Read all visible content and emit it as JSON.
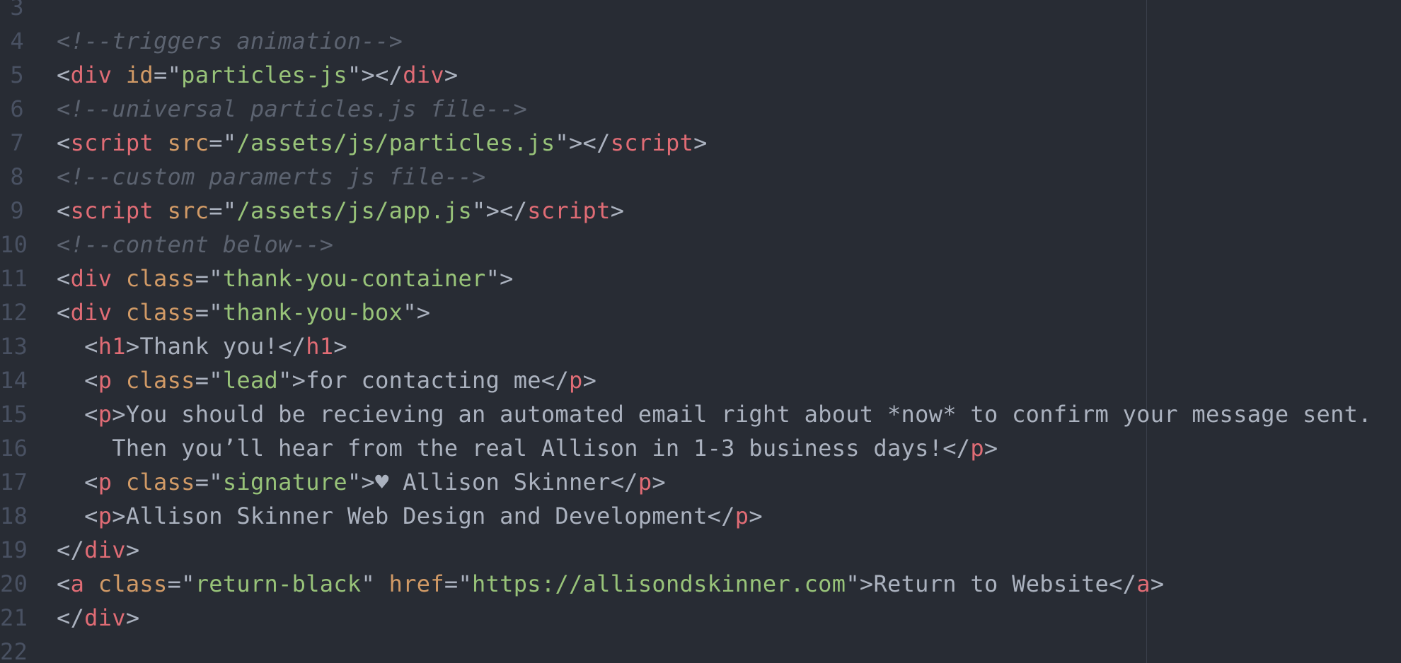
{
  "editor": {
    "colors": {
      "background": "#282c34",
      "tag": "#e06c75",
      "attribute": "#d19a66",
      "string": "#98c379",
      "comment": "#5c6370",
      "text": "#abb2bf",
      "gutter": "#495162"
    },
    "lines": [
      {
        "num": "3"
      },
      {
        "num": "4",
        "comment": "<!--triggers animation-->"
      },
      {
        "num": "5",
        "open": "<",
        "tag": "div",
        "attr": "id",
        "eq": "=\"",
        "val": "particles-js",
        "close": "\"></",
        "tag2": "div",
        "end": ">"
      },
      {
        "num": "6",
        "comment": "<!--universal particles.js file-->"
      },
      {
        "num": "7",
        "open": "<",
        "tag": "script",
        "attr": "src",
        "eq": "=\"",
        "val": "/assets/js/particles.js",
        "close": "\"></",
        "tag2": "script",
        "end": ">"
      },
      {
        "num": "8",
        "comment": "<!--custom paramerts js file-->"
      },
      {
        "num": "9",
        "open": "<",
        "tag": "script",
        "attr": "src",
        "eq": "=\"",
        "val": "/assets/js/app.js",
        "close": "\"></",
        "tag2": "script",
        "end": ">"
      },
      {
        "num": "10",
        "comment": "<!--content below-->"
      },
      {
        "num": "11",
        "open": "<",
        "tag": "div",
        "attr": "class",
        "eq": "=\"",
        "val": "thank-you-container",
        "end": "\">"
      },
      {
        "num": "12",
        "open": "<",
        "tag": "div",
        "attr": "class",
        "eq": "=\"",
        "val": "thank-you-box",
        "end": "\">"
      },
      {
        "num": "13",
        "indent": "  ",
        "open": "<",
        "tag": "h1",
        "mid": ">",
        "text": "Thank you!",
        "close": "</",
        "tag2": "h1",
        "end": ">"
      },
      {
        "num": "14",
        "indent": "  ",
        "open": "<",
        "tag": "p",
        "attr": "class",
        "eq": "=\"",
        "val": "lead",
        "mid": "\">",
        "text": "for contacting me",
        "close": "</",
        "tag2": "p",
        "end": ">"
      },
      {
        "num": "15",
        "indent": "  ",
        "open": "<",
        "tag": "p",
        "mid": ">",
        "text": "You should be recieving an automated email right about *now* to confirm your message sent."
      },
      {
        "num": "16",
        "indent": "    ",
        "text": "Then you’ll hear from the real Allison in 1-3 business days!",
        "close": "</",
        "tag2": "p",
        "end": ">"
      },
      {
        "num": "17",
        "indent": "  ",
        "open": "<",
        "tag": "p",
        "attr": "class",
        "eq": "=\"",
        "val": "signature",
        "mid": "\">",
        "text": "♥ Allison Skinner",
        "close": "</",
        "tag2": "p",
        "end": ">"
      },
      {
        "num": "18",
        "indent": "  ",
        "open": "<",
        "tag": "p",
        "mid": ">",
        "text": "Allison Skinner Web Design and Development",
        "close": "</",
        "tag2": "p",
        "end": ">"
      },
      {
        "num": "19",
        "open": "</",
        "tag": "div",
        "end": ">"
      },
      {
        "num": "20",
        "open": "<",
        "tag": "a",
        "attr": "class",
        "eq": "=\"",
        "val": "return-black",
        "q": "\" ",
        "attr2": "href",
        "eq2": "=\"",
        "val2": "https://allisondskinner.com",
        "mid": "\">",
        "text": "Return to Website",
        "close": "</",
        "tag2": "a",
        "end": ">"
      },
      {
        "num": "21",
        "open": "</",
        "tag": "div",
        "end": ">"
      },
      {
        "num": "22"
      }
    ]
  }
}
